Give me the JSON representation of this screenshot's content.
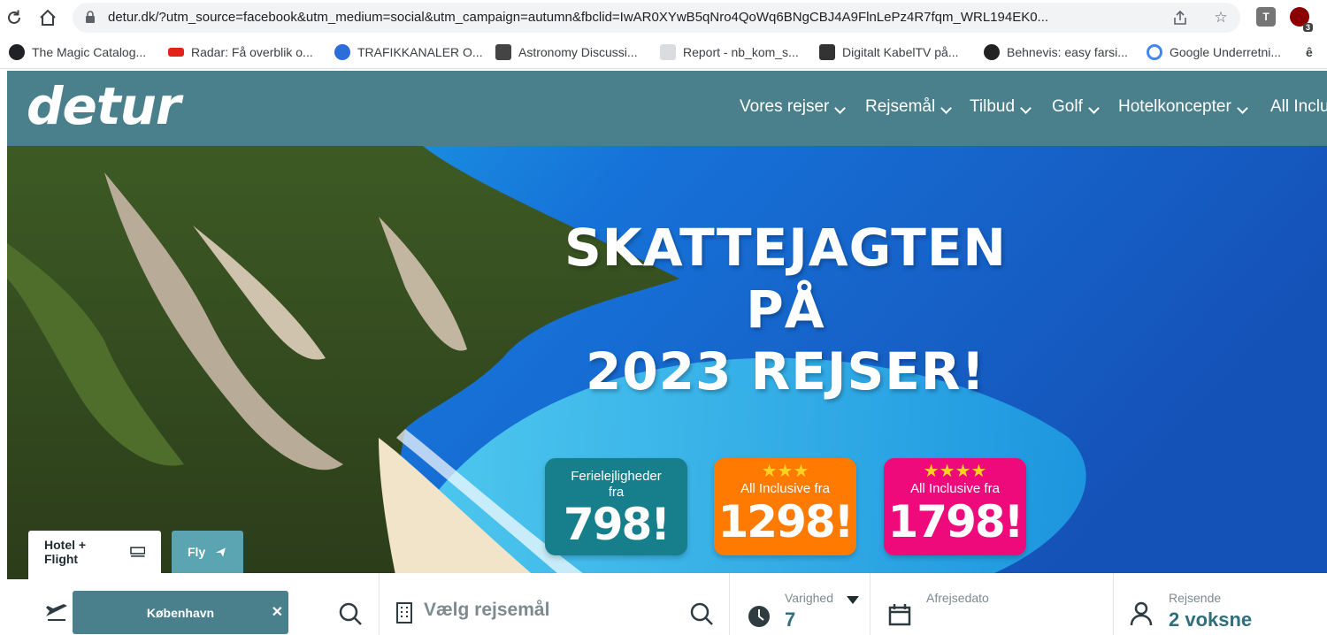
{
  "browser": {
    "url": "detur.dk/?utm_source=facebook&utm_medium=social&utm_campaign=autumn&fbclid=IwAR0XYwB5qNro4QoWq6BNgCBJ4A9FlnLePz4R7fqm_WRL194EK0...",
    "extension_badge": "3",
    "ext_t_label": "T",
    "bookmarks": [
      {
        "label": "The Magic Catalog...",
        "icon": "globe-icon",
        "color": "#202124"
      },
      {
        "label": "Radar: Få overblik o...",
        "icon": "tv2-icon",
        "color": "#e2231a"
      },
      {
        "label": "TRAFIKKANALER O...",
        "icon": "trafik-icon",
        "color": "#2b6ed9"
      },
      {
        "label": "Astronomy Discussi...",
        "icon": "astronomy-icon",
        "color": "#444444"
      },
      {
        "label": "Report - nb_kom_s...",
        "icon": "mail-icon",
        "color": "#9aa0a6"
      },
      {
        "label": "Digitalt KabelTV på...",
        "icon": "cabletv-icon",
        "color": "#333333"
      },
      {
        "label": "Behnevis: easy farsi...",
        "icon": "behnevis-icon",
        "color": "#222222"
      },
      {
        "label": "Google Underretni...",
        "icon": "google-icon",
        "color": "#4285f4"
      }
    ],
    "bookmarks_more": "ê"
  },
  "site": {
    "logo": "detur",
    "nav": [
      "Vores rejser",
      "Rejsemål",
      "Tilbud",
      "Golf",
      "Hotelkoncepter",
      "All Inclu"
    ],
    "headline": [
      "SKATTEJAGTEN PÅ",
      "2023 REJSER!"
    ],
    "offers": [
      {
        "subtitle_1": "Ferielejligheder",
        "subtitle_2": "fra",
        "price": "798!",
        "stars": "",
        "color": "#177f8b"
      },
      {
        "subtitle_1": "All Inclusive fra",
        "subtitle_2": "",
        "price": "1298!",
        "stars": "★★★",
        "color": "#ff7a00"
      },
      {
        "subtitle_1": "All Inclusive fra",
        "subtitle_2": "",
        "price": "1798!",
        "stars": "★★★★",
        "color": "#ef0a7b"
      }
    ],
    "tabs": {
      "hotel_flight": "Hotel + Flight",
      "fly": "Fly"
    },
    "search": {
      "origin": "København",
      "destination_placeholder": "Vælg rejsemål",
      "duration_label": "Varighed",
      "duration_value": "7",
      "departure_label": "Afrejsedato",
      "travelers_label": "Rejsende",
      "travelers_value": "2 voksne"
    },
    "colors": {
      "header": "#4a7f8c",
      "accent": "#2f6f7c",
      "tab_fly": "#5ba5b3"
    }
  }
}
